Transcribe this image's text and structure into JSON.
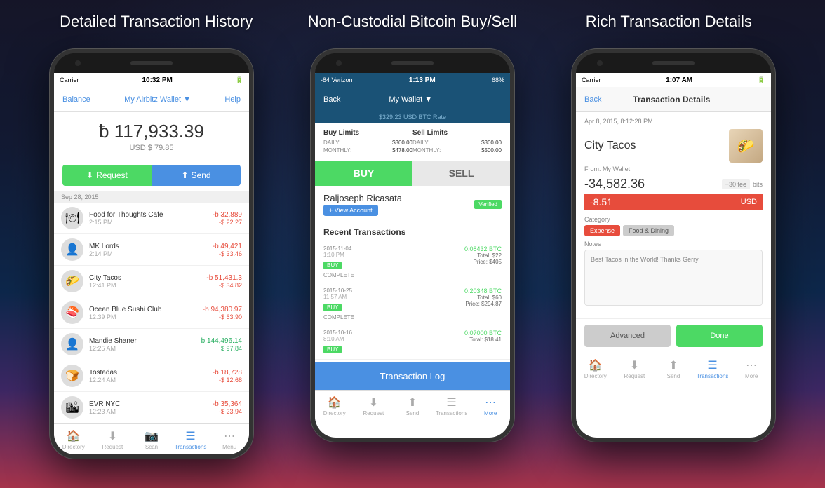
{
  "page": {
    "background": "#0a0a1a",
    "titles": [
      "Detailed Transaction History",
      "Non-Custodial Bitcoin Buy/Sell",
      "Rich Transaction Details"
    ]
  },
  "phone1": {
    "status_bar": {
      "carrier": "Carrier",
      "wifi": "WiFi",
      "time": "10:32 PM",
      "battery": "■■■"
    },
    "nav": {
      "balance": "Balance",
      "wallet": "My Airbitz Wallet ▼",
      "help": "Help"
    },
    "balance": {
      "btc": "ƀ 117,933.39",
      "usd": "USD $ 79.85"
    },
    "buttons": {
      "request": "Request",
      "send": "Send"
    },
    "date_separator": "Sep 28, 2015",
    "transactions": [
      {
        "name": "Food for Thoughts Cafe",
        "time": "2:15 PM",
        "btc": "-b 32,889",
        "usd": "-$ 22.27",
        "positive": false
      },
      {
        "name": "MK Lords",
        "time": "2:14 PM",
        "btc": "-b 49,421",
        "usd": "-$ 33.46",
        "positive": false
      },
      {
        "name": "City Tacos",
        "time": "12:41 PM",
        "btc": "-b 51,431.3",
        "usd": "-$ 34.82",
        "positive": false
      },
      {
        "name": "Ocean Blue Sushi Club",
        "time": "12:39 PM",
        "btc": "-b 94,380.97",
        "usd": "-$ 63.90",
        "positive": false
      },
      {
        "name": "Mandie Shaner",
        "time": "12:25 AM",
        "btc": "b 144,496.14",
        "usd": "$ 97.84",
        "positive": true
      },
      {
        "name": "Tostadas",
        "time": "12:24 AM",
        "btc": "-b 18,728",
        "usd": "-$ 12.68",
        "positive": false
      },
      {
        "name": "EVR NYC",
        "time": "12:23 AM",
        "btc": "-b 35,364",
        "usd": "-$ 23.94",
        "positive": false
      }
    ],
    "tabs": [
      {
        "icon": "🏠",
        "label": "Directory",
        "active": false
      },
      {
        "icon": "⬇",
        "label": "Request",
        "active": false
      },
      {
        "icon": "📷",
        "label": "Scan",
        "active": false
      },
      {
        "icon": "☰",
        "label": "Transactions",
        "active": true
      },
      {
        "icon": "⋯",
        "label": "Menu",
        "active": false
      }
    ]
  },
  "phone2": {
    "status_bar": {
      "carrier": "-84 Verizon",
      "wifi": "WiFi",
      "time": "1:13 PM",
      "battery": "68%"
    },
    "nav": {
      "back": "Back",
      "wallet": "My Wallet ▼"
    },
    "btc_rate": "$329.23 USD BTC Rate",
    "limits": {
      "buy": {
        "title": "Buy Limits",
        "daily_label": "DAILY:",
        "daily_value": "$300.00",
        "monthly_label": "MONTHLY:",
        "monthly_value": "$478.00"
      },
      "sell": {
        "title": "Sell Limits",
        "daily_label": "DAILY:",
        "daily_value": "$300.00",
        "monthly_label": "MONTHLY:",
        "monthly_value": "$500.00"
      }
    },
    "tabs_buy_sell": {
      "buy": "BUY",
      "sell": "SELL"
    },
    "user": {
      "name": "Raljoseph Ricasata",
      "view_account": "+ View Account",
      "verified": "Verified"
    },
    "recent_tx_title": "Recent Transactions",
    "transactions": [
      {
        "date": "2015-11-04",
        "time": "1:10 PM",
        "type": "BUY",
        "status": "COMPLETE",
        "btc": "0.08432 BTC",
        "total": "Total: $22",
        "price": "Price: $405"
      },
      {
        "date": "2015-10-25",
        "time": "11:57 AM",
        "type": "BUY",
        "status": "COMPLETE",
        "btc": "0.20348 BTC",
        "total": "Total: $60",
        "price": "Price: $294.87"
      },
      {
        "date": "2015-10-16",
        "time": "8:10 AM",
        "type": "BUY",
        "status": "",
        "btc": "0.07000 BTC",
        "total": "Total: $18.41",
        "price": ""
      }
    ],
    "tx_log_button": "Transaction Log",
    "tabs": [
      {
        "icon": "🏠",
        "label": "Directory",
        "active": false
      },
      {
        "icon": "⬇",
        "label": "Request",
        "active": false
      },
      {
        "icon": "⬆",
        "label": "Send",
        "active": false
      },
      {
        "icon": "☰",
        "label": "Transactions",
        "active": false
      },
      {
        "icon": "⋯",
        "label": "More",
        "active": true
      }
    ]
  },
  "phone3": {
    "status_bar": {
      "carrier": "Carrier",
      "wifi": "WiFi",
      "time": "1:07 AM",
      "battery": "■■■"
    },
    "nav": {
      "back": "Back",
      "title": "Transaction Details"
    },
    "tx_date": "Apr 8, 2015, 8:12:28 PM",
    "merchant": {
      "name": "City Tacos",
      "image_emoji": "🌮"
    },
    "from_wallet": "From: My Wallet",
    "amounts": {
      "btc_neg": "-34,582.36",
      "fee": "+30 fee",
      "fee_unit": "bits",
      "usd_neg": "-8.51",
      "usd_unit": "USD"
    },
    "category": {
      "label": "Category",
      "expense": "Expense",
      "food": "Food & Dining"
    },
    "notes": {
      "label": "Notes",
      "text": "Best Tacos in the World!  Thanks Gerry"
    },
    "actions": {
      "advanced": "Advanced",
      "done": "Done"
    },
    "tabs": [
      {
        "icon": "🏠",
        "label": "Directory",
        "active": false
      },
      {
        "icon": "⬇",
        "label": "Request",
        "active": false
      },
      {
        "icon": "⬆",
        "label": "Send",
        "active": false
      },
      {
        "icon": "☰",
        "label": "Transactions",
        "active": true
      },
      {
        "icon": "⋯",
        "label": "More",
        "active": false
      }
    ]
  }
}
